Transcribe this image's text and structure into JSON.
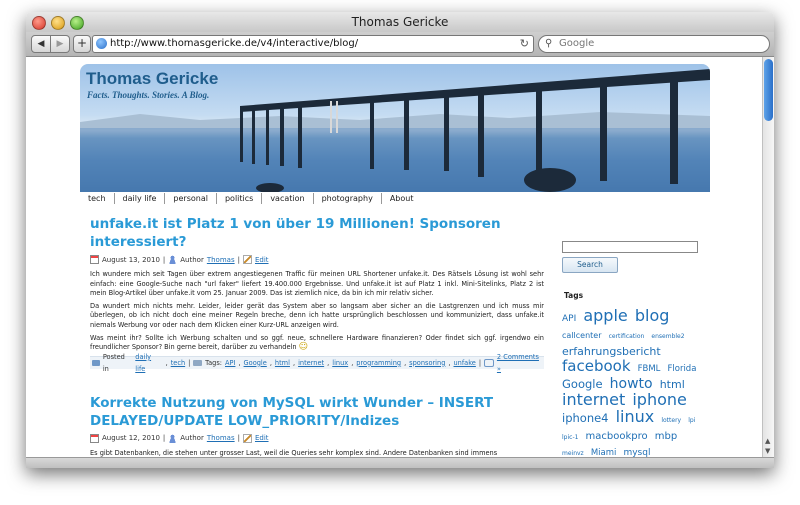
{
  "browser": {
    "window_title": "Thomas Gericke",
    "url": "http://www.thomasgericke.de/v4/interactive/blog/",
    "search_placeholder": "Google",
    "back_icon": "◀",
    "forward_icon": "▶",
    "add_icon": "+",
    "reload_icon": "↻",
    "search_icon": "⚲"
  },
  "site": {
    "title": "Thomas Gericke",
    "tagline": "Facts. Thoughts. Stories. A Blog."
  },
  "nav": [
    "tech",
    "daily life",
    "personal",
    "politics",
    "vacation",
    "photography",
    "About"
  ],
  "posts": [
    {
      "title": "unfake.it ist Platz 1 von über 19 Millionen! Sponsoren interessiert?",
      "date": "August 13, 2010",
      "author_prefix": "Author",
      "author": "Thomas",
      "edit": "Edit",
      "p1": "Ich wundere mich seit Tagen über extrem angestiegenen Traffic für meinen URL Shortener unfake.it. Des Rätsels Lösung ist wohl sehr einfach: eine Google-Suche nach \"url faker\" liefert 19.400.000 Ergebnisse. Und unfake.it ist auf Platz 1 inkl. Mini-Sitelinks, Platz 2 ist mein Blog-Artikel über unfake.it vom 25. Januar 2009. Das ist ziemlich nice, da bin ich mir relativ sicher.",
      "p2": "Da wundert mich nichts mehr. Leider, leider gerät das System aber so langsam aber sicher an die Lastgrenzen und ich muss mir überlegen, ob ich nicht doch eine meiner Regeln breche, denn ich hatte ursprünglich beschlossen und kommuniziert, dass unfake.it niemals Werbung vor oder nach dem Klicken einer Kurz-URL anzeigen wird.",
      "p3": "Was meint ihr? Sollte ich Werbung schalten und so ggf. neue, schnellere Hardware finanzieren? Oder findet sich ggf. irgendwo ein freundlicher Sponsor? Bin gerne bereit, darüber zu verhandeln",
      "smiley": "☺",
      "posted_in_prefix": "Posted in",
      "categories": [
        "daily life",
        "tech"
      ],
      "tags_prefix": "Tags:",
      "tags": [
        "API",
        "Google",
        "html",
        "internet",
        "linux",
        "programming",
        "sponsoring",
        "unfake"
      ],
      "comments": "2 Comments »"
    },
    {
      "title": "Korrekte Nutzung von MySQL wirkt Wunder – INSERT DELAYED/UPDATE LOW_PRIORITY/Indizes",
      "date": "August 12, 2010",
      "author_prefix": "Author",
      "author": "Thomas",
      "edit": "Edit",
      "p1": "Es gibt Datenbanken, die stehen unter grosser Last, weil die Queries sehr komplex sind. Andere Datenbanken sind immens"
    }
  ],
  "sidebar": {
    "search_button": "Search",
    "tags_heading": "Tags",
    "tagcloud": [
      {
        "text": "API",
        "size": 9
      },
      {
        "text": "apple",
        "size": 16
      },
      {
        "text": "blog",
        "size": 16
      },
      {
        "text": "callcenter",
        "size": 8
      },
      {
        "text": "certification",
        "size": 6
      },
      {
        "text": "ensemble2",
        "size": 6
      },
      {
        "text": "erfahrungsbericht",
        "size": 11
      },
      {
        "text": "facebook",
        "size": 15
      },
      {
        "text": "FBML",
        "size": 8.5
      },
      {
        "text": "Florida",
        "size": 8.5
      },
      {
        "text": "Google",
        "size": 11.5
      },
      {
        "text": "howto",
        "size": 14
      },
      {
        "text": "html",
        "size": 11
      },
      {
        "text": "internet",
        "size": 16
      },
      {
        "text": "iphone",
        "size": 16
      },
      {
        "text": "iphone4",
        "size": 11.5
      },
      {
        "text": "linux",
        "size": 16
      },
      {
        "text": "lottery",
        "size": 6
      },
      {
        "text": "lpi",
        "size": 6
      },
      {
        "text": "lpic-1",
        "size": 6
      },
      {
        "text": "macbookpro",
        "size": 10
      },
      {
        "text": "mbp",
        "size": 10
      },
      {
        "text": "meinvz",
        "size": 6
      },
      {
        "text": "Miami",
        "size": 8.5
      },
      {
        "text": "mysql",
        "size": 9
      }
    ]
  }
}
